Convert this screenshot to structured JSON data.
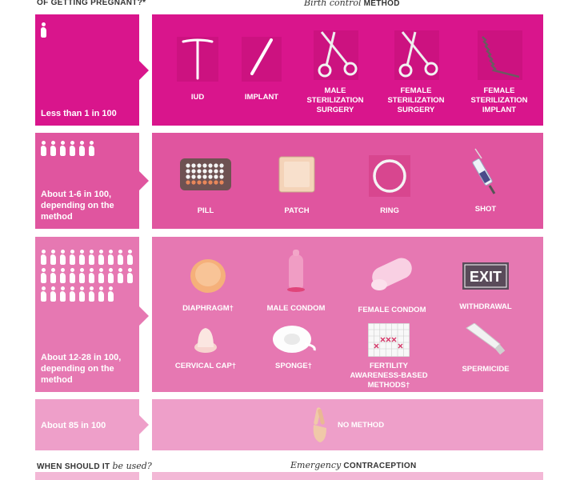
{
  "headers": {
    "left_top": "OF GETTING PREGNANT?*",
    "right_top_script": "Birth control",
    "right_top_rest": "METHOD",
    "left_bottom_rest": "WHEN SHOULD IT",
    "left_bottom_script": "be used?",
    "right_bottom_script": "Emergency",
    "right_bottom_rest": "CONTRACEPTION"
  },
  "colors": {
    "tier1": "#d9158c",
    "tier2": "#e0559f",
    "tier3": "#e678b2",
    "tier4": "#ee9fc9"
  },
  "tiers": [
    {
      "rate": "Less than 1 in 100",
      "icon_count": 1,
      "methods": [
        {
          "label": "IUD",
          "icon": "iud-icon"
        },
        {
          "label": "IMPLANT",
          "icon": "implant-icon"
        },
        {
          "label": "MALE STERILIZATION SURGERY",
          "icon": "scissors-icon"
        },
        {
          "label": "FEMALE STERILIZATION SURGERY",
          "icon": "scissors-icon"
        },
        {
          "label": "FEMALE STERILIZATION IMPLANT",
          "icon": "coil-icon"
        }
      ]
    },
    {
      "rate": "About 1-6 in 100, depending on the method",
      "icon_count": 6,
      "methods": [
        {
          "label": "PILL",
          "icon": "pill-pack-icon"
        },
        {
          "label": "PATCH",
          "icon": "patch-icon"
        },
        {
          "label": "RING",
          "icon": "ring-icon"
        },
        {
          "label": "SHOT",
          "icon": "syringe-icon"
        }
      ]
    },
    {
      "rate": "About 12-28 in 100, depending on the method",
      "icon_count": 28,
      "methods": [
        {
          "label": "DIAPHRAGM†",
          "icon": "diaphragm-icon"
        },
        {
          "label": "MALE CONDOM",
          "icon": "male-condom-icon"
        },
        {
          "label": "FEMALE CONDOM",
          "icon": "female-condom-icon"
        },
        {
          "label": "WITHDRAWAL",
          "icon": "exit-sign-icon",
          "sign_text": "EXIT"
        },
        {
          "label": "CERVICAL CAP†",
          "icon": "cervical-cap-icon"
        },
        {
          "label": "SPONGE†",
          "icon": "sponge-icon"
        },
        {
          "label": "FERTILITY AWARENESS-BASED METHODS†",
          "icon": "calendar-icon"
        },
        {
          "label": "SPERMICIDE",
          "icon": "tube-icon"
        }
      ]
    },
    {
      "rate": "About 85 in 100",
      "methods": [
        {
          "label": "NO METHOD",
          "icon": "crossed-fingers-icon"
        }
      ]
    }
  ]
}
